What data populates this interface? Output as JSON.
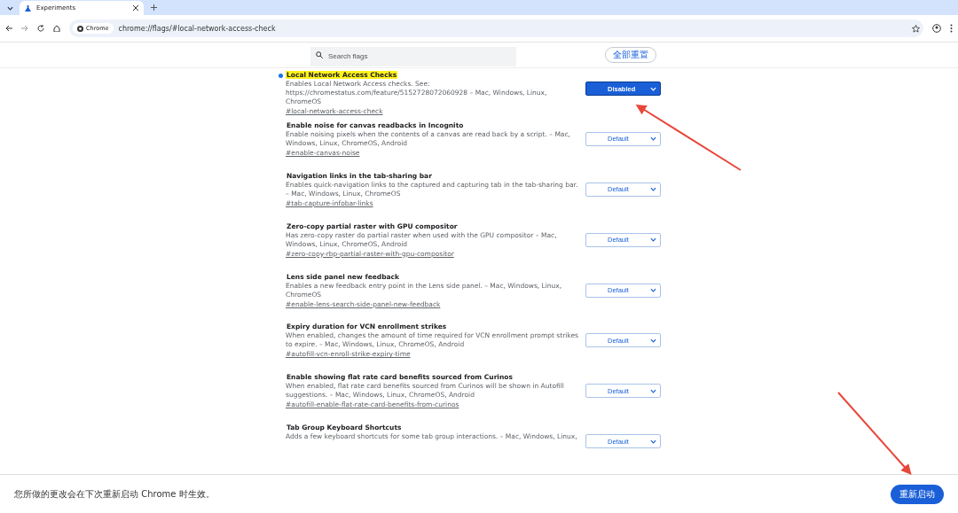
{
  "tab": {
    "title": "Experiments",
    "selected": true
  },
  "address": {
    "chip": "Chrome",
    "url": "chrome://flags/#local-network-access-check"
  },
  "search": {
    "placeholder": "Search flags"
  },
  "reset_button": "全部重置",
  "flags": [
    {
      "title": "Local Network Access Checks",
      "highlighted": true,
      "modified": true,
      "description": "Enables Local Network Access checks. See: https://chromestatus.com/feature/5152728072060928 – Mac, Windows, Linux, ChromeOS",
      "link": "#local-network-access-check",
      "value": "Disabled"
    },
    {
      "title": "Enable noise for canvas readbacks in Incognito",
      "highlighted": false,
      "modified": false,
      "description": "Enable noising pixels when the contents of a canvas are read back by a script. – Mac, Windows, Linux, ChromeOS, Android",
      "link": "#enable-canvas-noise",
      "value": "Default"
    },
    {
      "title": "Navigation links in the tab-sharing bar",
      "highlighted": false,
      "modified": false,
      "description": "Enables quick-navigation links to the captured and capturing tab in the tab-sharing bar. – Mac, Windows, Linux, ChromeOS",
      "link": "#tab-capture-infobar-links",
      "value": "Default"
    },
    {
      "title": "Zero-copy partial raster with GPU compositor",
      "highlighted": false,
      "modified": false,
      "description": "Has zero-copy raster do partial raster when used with the GPU compositor – Mac, Windows, Linux, ChromeOS, Android",
      "link": "#zero-copy-rbp-partial-raster-with-gpu-compositor",
      "value": "Default"
    },
    {
      "title": "Lens side panel new feedback",
      "highlighted": false,
      "modified": false,
      "description": "Enables a new feedback entry point in the Lens side panel. – Mac, Windows, Linux, ChromeOS",
      "link": "#enable-lens-search-side-panel-new-feedback",
      "value": "Default"
    },
    {
      "title": "Expiry duration for VCN enrollment strikes",
      "highlighted": false,
      "modified": false,
      "description": "When enabled, changes the amount of time required for VCN enrollment prompt strikes to expire. – Mac, Windows, Linux, ChromeOS, Android",
      "link": "#autofill-vcn-enroll-strike-expiry-time",
      "value": "Default"
    },
    {
      "title": "Enable showing flat rate card benefits sourced from Curinos",
      "highlighted": false,
      "modified": false,
      "description": "When enabled, flat rate card benefits sourced from Curinos will be shown in Autofill suggestions. – Mac, Windows, Linux, ChromeOS, Android",
      "link": "#autofill-enable-flat-rate-card-benefits-from-curinos",
      "value": "Default"
    },
    {
      "title": "Tab Group Keyboard Shortcuts",
      "highlighted": false,
      "modified": false,
      "description": "Adds a few keyboard shortcuts for some tab group interactions. – Mac, Windows, Linux,",
      "value": "Default"
    }
  ],
  "footer": {
    "message": "您所做的更改会在下次重新启动 Chrome 时生效。",
    "button": "重新启动"
  }
}
